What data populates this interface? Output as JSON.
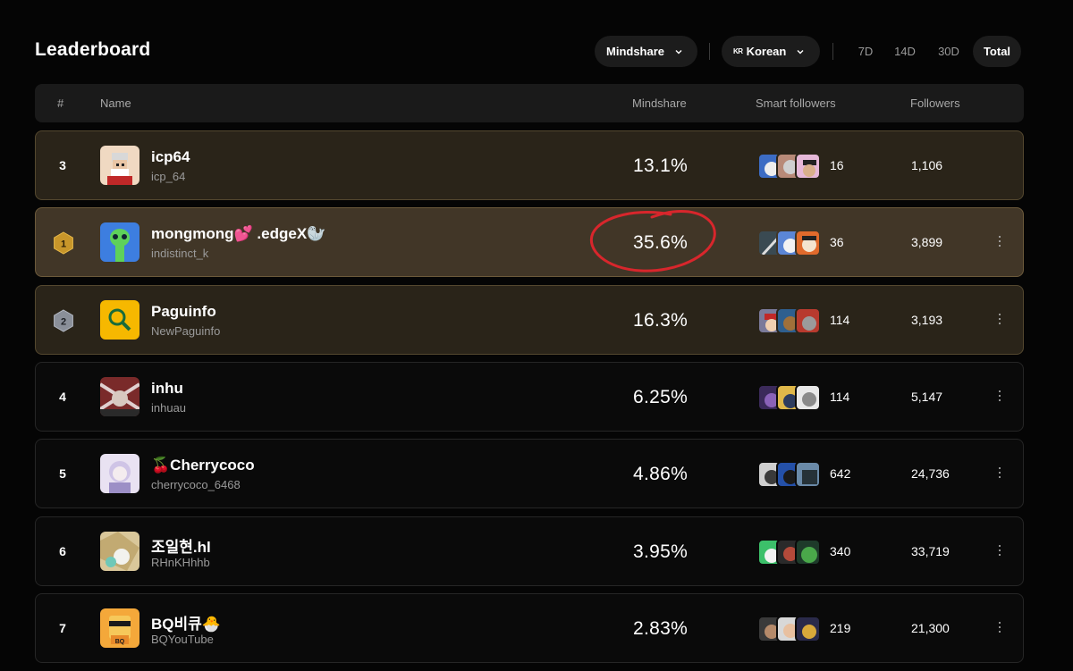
{
  "header": {
    "title": "Leaderboard",
    "metric_select": "Mindshare",
    "language_flag": "KR",
    "language_select": "Korean",
    "periods": [
      "7D",
      "14D",
      "30D",
      "Total"
    ],
    "active_period": "Total"
  },
  "table": {
    "columns": [
      "#",
      "Name",
      "Mindshare",
      "Smart followers",
      "Followers"
    ],
    "rows": [
      {
        "rank": "3",
        "badge": "none",
        "name": "icp64",
        "handle": "icp_64",
        "mindshare": "13.1%",
        "smart_followers": "16",
        "followers": "1,106",
        "menu": false,
        "style": "highlight"
      },
      {
        "rank": "1",
        "badge": "gold",
        "name": "mongmong💕 .edgeX🦭",
        "handle": "indistinct_k",
        "mindshare": "35.6%",
        "smart_followers": "36",
        "followers": "3,899",
        "menu": true,
        "style": "top"
      },
      {
        "rank": "2",
        "badge": "silver",
        "name": "Paguinfo",
        "handle": "NewPaguinfo",
        "mindshare": "16.3%",
        "smart_followers": "114",
        "followers": "3,193",
        "menu": true,
        "style": "highlight"
      },
      {
        "rank": "4",
        "badge": "none",
        "name": "inhu",
        "handle": "inhuau",
        "mindshare": "6.25%",
        "smart_followers": "114",
        "followers": "5,147",
        "menu": true,
        "style": "plain"
      },
      {
        "rank": "5",
        "badge": "none",
        "name": "🍒Cherrycoco",
        "handle": "cherrycoco_6468",
        "mindshare": "4.86%",
        "smart_followers": "642",
        "followers": "24,736",
        "menu": true,
        "style": "plain"
      },
      {
        "rank": "6",
        "badge": "none",
        "name": "조일현.hl",
        "handle": "RHnKHhhb",
        "mindshare": "3.95%",
        "smart_followers": "340",
        "followers": "33,719",
        "menu": true,
        "style": "plain"
      },
      {
        "rank": "7",
        "badge": "none",
        "name": "BQ비큐🐣",
        "handle": "BQYouTube",
        "mindshare": "2.83%",
        "smart_followers": "219",
        "followers": "21,300",
        "menu": true,
        "style": "plain"
      }
    ]
  },
  "annotation": {
    "color": "#d8262c"
  },
  "colors": {
    "background": "#050505",
    "gold": "#c8962a",
    "silver": "#8a8f99",
    "top_row": "#413627",
    "highlight_row": "#2a2419"
  }
}
